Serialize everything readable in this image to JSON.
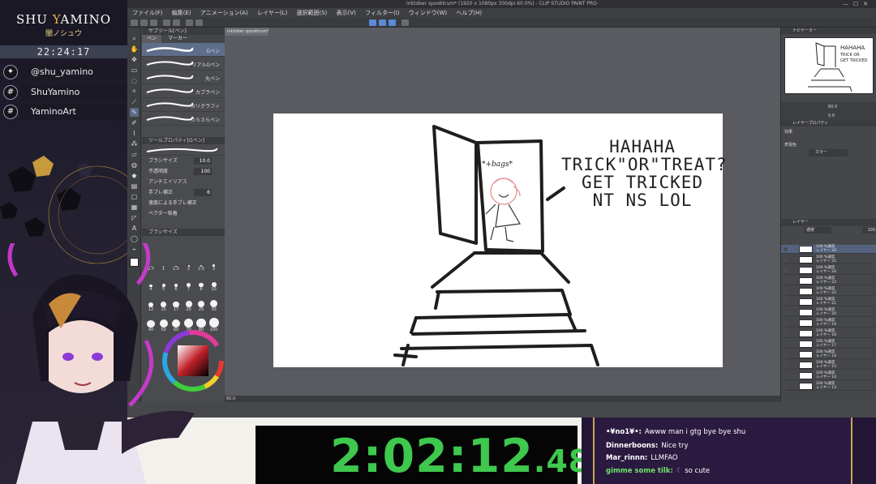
{
  "overlay": {
    "brand_name_pre": "SHU ",
    "brand_name_y": "Y",
    "brand_name_post": "AMINO",
    "brand_jp": "闇ノシュウ",
    "clock": "22:24:17",
    "socials": [
      {
        "icon": "twitter-icon",
        "glyph": "✦",
        "handle": "@shu_yamino"
      },
      {
        "icon": "hash-icon",
        "glyph": "#",
        "handle": "ShuYamino"
      },
      {
        "icon": "hash-icon",
        "glyph": "#",
        "handle": "YaminoArt"
      }
    ],
    "accent_color": "#e6b84a"
  },
  "app": {
    "title": "inktober spooktrum* (1920 x 1080px 300dpi 60.0%) - CLIP STUDIO PAINT PRO",
    "menu": [
      "ファイル(F)",
      "編集(E)",
      "アニメーション(A)",
      "レイヤー(L)",
      "選択範囲(S)",
      "表示(V)",
      "フィルター(I)",
      "ウィンドウ(W)",
      "ヘルプ(H)"
    ],
    "doc_tab": "inktober spooktrum*",
    "subtool": {
      "header": "サブツール[ペン]",
      "tabs": [
        "ペン",
        "マーカー"
      ],
      "brushes": [
        "Gペン",
        "リアルGペン",
        "丸ペン",
        "カブラペン",
        "カリグラフィ",
        "さらさらペン"
      ],
      "detail_header": "ツールプロパティ[Gペン]",
      "props": [
        {
          "label": "ブラシサイズ",
          "value": "10.0"
        },
        {
          "label": "不透明度",
          "value": "100"
        },
        {
          "label": "アンチエイリアス",
          "value": ""
        },
        {
          "label": "手ブレ補正",
          "value": "6"
        },
        {
          "label": "速度による手ブレ補正",
          "value": ""
        },
        {
          "label": "ベクター吸着",
          "value": ""
        }
      ],
      "size_header": "ブラシサイズ",
      "sizes": [
        "0.7",
        "1",
        "1.5",
        "2",
        "2.5",
        "3",
        "4",
        "5",
        "6",
        "7",
        "8",
        "10",
        "12",
        "15",
        "17",
        "20",
        "25",
        "30",
        "40",
        "50",
        "60",
        "70",
        "80",
        "100"
      ]
    },
    "canvas": {
      "caption": [
        "HAHAHA",
        "TRICK\"OR\"TREAT?",
        "GET TRICKED",
        "NT NS LOL"
      ],
      "tag": "*+bags*",
      "status": "60.0"
    },
    "right": {
      "navigator": "ナビゲーター",
      "zoom": "60.0",
      "rotate": "0.0",
      "layer_prop": "レイヤープロパティ",
      "effect": "効果",
      "expression_color": "表現色",
      "color_value": "カラー",
      "layer_header": "レイヤー",
      "blend": "通常",
      "opacity": "100",
      "layers": [
        {
          "pct": "100 %通常",
          "name": "レイヤー 26"
        },
        {
          "pct": "100 %通常",
          "name": "レイヤー 25"
        },
        {
          "pct": "100 %通常",
          "name": "レイヤー 24"
        },
        {
          "pct": "100 %通常",
          "name": "レイヤー 23"
        },
        {
          "pct": "100 %通常",
          "name": "レイヤー 22"
        },
        {
          "pct": "100 %通常",
          "name": "レイヤー 21"
        },
        {
          "pct": "100 %通常",
          "name": "レイヤー 20"
        },
        {
          "pct": "100 %通常",
          "name": "レイヤー 19"
        },
        {
          "pct": "100 %通常",
          "name": "レイヤー 18"
        },
        {
          "pct": "100 %通常",
          "name": "レイヤー 17"
        },
        {
          "pct": "100 %通常",
          "name": "レイヤー 16"
        },
        {
          "pct": "100 %通常",
          "name": "レイヤー 15"
        },
        {
          "pct": "100 %通常",
          "name": "レイヤー 14"
        },
        {
          "pct": "100 %通常",
          "name": "レイヤー 13"
        }
      ]
    }
  },
  "timer": {
    "main": "2:02:12",
    "ms": ".48",
    "color": "#3ec84d"
  },
  "chat": [
    {
      "user": "•¥no1¥•:",
      "msg": "Awww man i gtg bye bye shu",
      "color": "#ffffff"
    },
    {
      "user": "Dinnerboons:",
      "msg": "Nice try",
      "color": "#ffffff"
    },
    {
      "user": "Mar_rinnn:",
      "msg": "LLMFAO",
      "color": "#ffffff"
    },
    {
      "user": "gimme some tilk:",
      "msg": "so cute",
      "color": "#6ee26a"
    }
  ]
}
